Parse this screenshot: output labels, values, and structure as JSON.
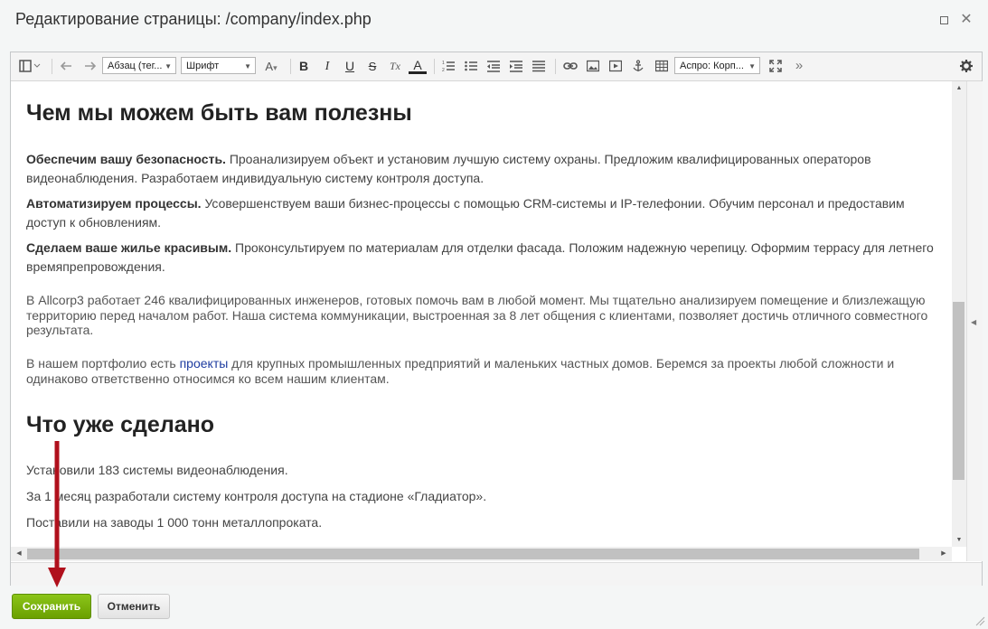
{
  "window": {
    "title": "Редактирование страницы: /company/index.php",
    "maximize_icon": "maximize-icon",
    "close_glyph": "✕"
  },
  "toolbar": {
    "paragraph_select": "Абзац (тег...",
    "font_select": "Шрифт",
    "font_size_label": "A",
    "style_select": "Аспро: Корп...",
    "more_glyph": "»",
    "bold": "B",
    "italic": "I",
    "underline": "U",
    "strike": "S",
    "clear_format": "Tx",
    "font_color": "A"
  },
  "content": {
    "heading1": "Чем мы можем быть вам полезны",
    "items": [
      {
        "bold": "Обеспечим вашу безопасность.",
        "text": " Проанализируем объект и установим лучшую систему охраны. Предложим квалифицированных операторов видеонаблюдения. Разработаем индивидуальную систему контроля доступа."
      },
      {
        "bold": "Автоматизируем процессы.",
        "text": " Усовершенствуем ваши бизнес-процессы с помощью CRM-системы и IP-телефонии. Обучим персонал и предоставим доступ к обновлениям."
      },
      {
        "bold": "Сделаем ваше жилье красивым.",
        "text": " Проконсультируем по материалам для отделки фасада. Положим надежную черепицу. Оформим террасу для летнего времяпрепровождения."
      }
    ],
    "para1": "В Allcorp3 работает 246 квалифицированных инженеров, готовых помочь вам в любой момент. Мы тщательно анализируем помещение и близлежащую территорию перед началом работ. Наша система коммуникации, выстроенная за 8 лет общения с клиентами, позволяет достичь отличного совместного результата.",
    "para2_before": "В нашем портфолио есть ",
    "para2_link": "проекты",
    "para2_after": " для крупных промышленных предприятий и маленьких частных домов. Беремся за проекты любой сложности и одинаково ответственно относимся ко всем нашим клиентам.",
    "heading2": "Что уже сделано",
    "done": [
      "Установили 183 системы видеонаблюдения.",
      "За 1 месяц разработали систему контроля доступа на стадионе «Гладиатор».",
      "Поставили на заводы 1 000 тонн металлопроката."
    ]
  },
  "buttons": {
    "save": "Сохранить",
    "cancel": "Отменить"
  },
  "colors": {
    "save_button": "#7ab20d",
    "annotation_arrow": "#b0101c",
    "link": "#1e3ca0"
  }
}
